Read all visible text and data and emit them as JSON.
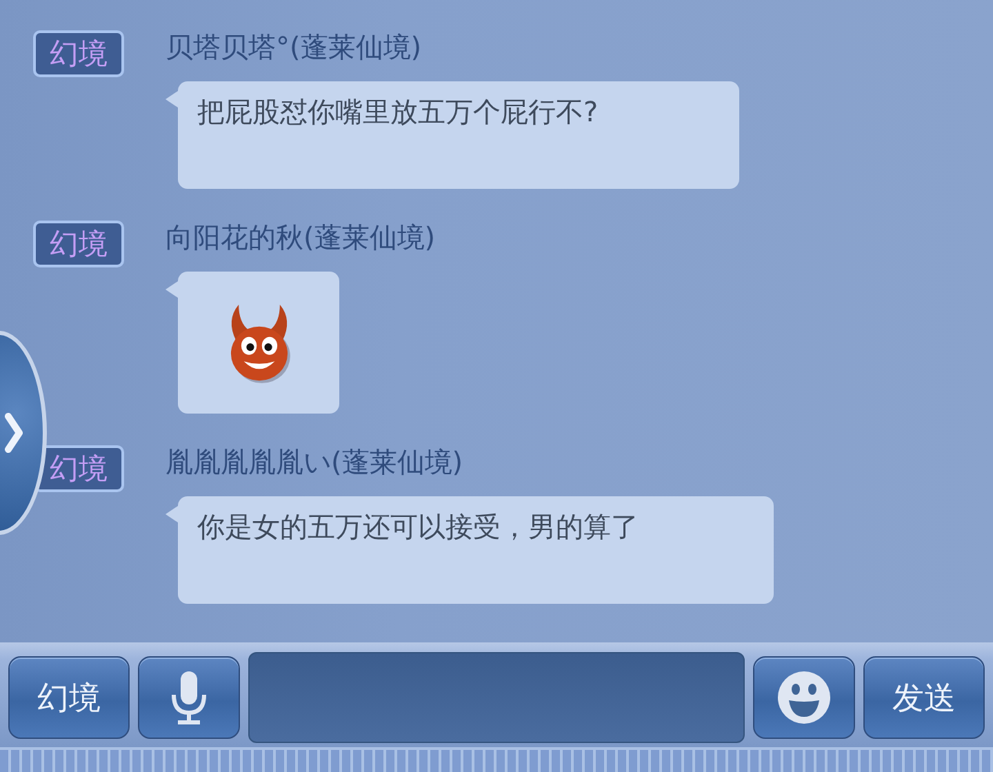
{
  "messages": [
    {
      "channel": "幻境",
      "sender": "贝塔贝塔°(蓬莱仙境)",
      "kind": "text",
      "text": "把屁股怼你嘴里放五万个屁行不?"
    },
    {
      "channel": "幻境",
      "sender": "向阳花的秋(蓬莱仙境)",
      "kind": "emoji"
    },
    {
      "channel": "幻境",
      "sender": "胤胤胤胤胤い(蓬莱仙境)",
      "kind": "text",
      "text": "你是女的五万还可以接受，男的算了"
    }
  ],
  "input_bar": {
    "channel_button": "幻境",
    "send_button": "发送"
  }
}
